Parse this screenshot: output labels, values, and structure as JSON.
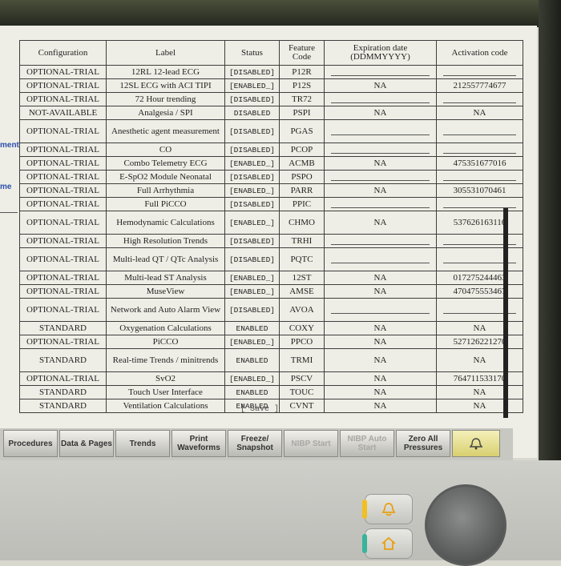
{
  "left_panel": {
    "item1": "ment",
    "item2": "me"
  },
  "table": {
    "headers": [
      "Configuration",
      "Label",
      "Status",
      "Feature Code",
      "Expiration date (DDMMYYYY)",
      "Activation code"
    ],
    "rows": [
      {
        "config": "OPTIONAL-TRIAL",
        "label": "12RL 12-lead ECG",
        "status": "[DISABLED]",
        "code": "P12R",
        "exp": "",
        "act": ""
      },
      {
        "config": "OPTIONAL-TRIAL",
        "label": "12SL ECG with ACI TIPI",
        "status": "[ENABLED_]",
        "code": "P12S",
        "exp": "NA",
        "act": "212557774677"
      },
      {
        "config": "OPTIONAL-TRIAL",
        "label": "72 Hour trending",
        "status": "[DISABLED]",
        "code": "TR72",
        "exp": "",
        "act": ""
      },
      {
        "config": "NOT-AVAILABLE",
        "label": "Analgesia / SPI",
        "status": "DISABLED",
        "code": "PSPI",
        "exp": "NA",
        "act": "NA"
      },
      {
        "config": "OPTIONAL-TRIAL",
        "label": "Anesthetic agent measurement",
        "status": "[DISABLED]",
        "code": "PGAS",
        "exp": "",
        "act": ""
      },
      {
        "config": "OPTIONAL-TRIAL",
        "label": "CO",
        "status": "[DISABLED]",
        "code": "PCOP",
        "exp": "",
        "act": ""
      },
      {
        "config": "OPTIONAL-TRIAL",
        "label": "Combo Telemetry ECG",
        "status": "[ENABLED_]",
        "code": "ACMB",
        "exp": "NA",
        "act": "475351677016"
      },
      {
        "config": "OPTIONAL-TRIAL",
        "label": "E-SpO2 Module Neonatal",
        "status": "[DISABLED]",
        "code": "PSPO",
        "exp": "",
        "act": ""
      },
      {
        "config": "OPTIONAL-TRIAL",
        "label": "Full Arrhythmia",
        "status": "[ENABLED_]",
        "code": "PARR",
        "exp": "NA",
        "act": "305531070461"
      },
      {
        "config": "OPTIONAL-TRIAL",
        "label": "Full PiCCO",
        "status": "[DISABLED]",
        "code": "PPIC",
        "exp": "",
        "act": ""
      },
      {
        "config": "OPTIONAL-TRIAL",
        "label": "Hemodynamic Calculations",
        "status": "[ENABLED_]",
        "code": "CHMO",
        "exp": "NA",
        "act": "537626163116"
      },
      {
        "config": "OPTIONAL-TRIAL",
        "label": "High Resolution Trends",
        "status": "[DISABLED]",
        "code": "TRHI",
        "exp": "",
        "act": ""
      },
      {
        "config": "OPTIONAL-TRIAL",
        "label": "Multi-lead QT / QTc Analysis",
        "status": "[DISABLED]",
        "code": "PQTC",
        "exp": "",
        "act": ""
      },
      {
        "config": "OPTIONAL-TRIAL",
        "label": "Multi-lead ST Analysis",
        "status": "[ENABLED_]",
        "code": "12ST",
        "exp": "NA",
        "act": "017275244463"
      },
      {
        "config": "OPTIONAL-TRIAL",
        "label": "MuseView",
        "status": "[ENABLED_]",
        "code": "AMSE",
        "exp": "NA",
        "act": "470475553467"
      },
      {
        "config": "OPTIONAL-TRIAL",
        "label": "Network and Auto Alarm View",
        "status": "[DISABLED]",
        "code": "AVOA",
        "exp": "",
        "act": ""
      },
      {
        "config": "STANDARD",
        "label": "Oxygenation Calculations",
        "status": "ENABLED",
        "code": "COXY",
        "exp": "NA",
        "act": "NA"
      },
      {
        "config": "OPTIONAL-TRIAL",
        "label": "PiCCO",
        "status": "[ENABLED_]",
        "code": "PPCO",
        "exp": "NA",
        "act": "527126221270"
      },
      {
        "config": "STANDARD",
        "label": "Real-time Trends / minitrends",
        "status": "ENABLED",
        "code": "TRMI",
        "exp": "NA",
        "act": "NA"
      },
      {
        "config": "OPTIONAL-TRIAL",
        "label": "SvO2",
        "status": "[ENABLED_]",
        "code": "PSCV",
        "exp": "NA",
        "act": "764711533170"
      },
      {
        "config": "STANDARD",
        "label": "Touch User Interface",
        "status": "ENABLED",
        "code": "TOUC",
        "exp": "NA",
        "act": "NA"
      },
      {
        "config": "STANDARD",
        "label": "Ventilation Calculations",
        "status": "ENABLED",
        "code": "CVNT",
        "exp": "NA",
        "act": "NA"
      }
    ]
  },
  "save_label": "[ Save ]",
  "bottom_buttons": [
    {
      "label": "Procedures",
      "enabled": true
    },
    {
      "label": "Data & Pages",
      "enabled": true
    },
    {
      "label": "Trends",
      "enabled": true
    },
    {
      "label": "Print Waveforms",
      "enabled": true
    },
    {
      "label": "Freeze/ Snapshot",
      "enabled": true
    },
    {
      "label": "NIBP Start",
      "enabled": false
    },
    {
      "label": "NIBP Auto Start",
      "enabled": false
    },
    {
      "label": "Zero All Pressures",
      "enabled": true
    }
  ],
  "colors": {
    "accent_link": "#2b4fae",
    "alarm_button": "#e6dd84",
    "alarm_key_led": "#f0c020",
    "home_key_led": "#39b39c"
  },
  "icons": {
    "alarm_button": "bell-alarm-icon",
    "alarm_key": "alarm-bell-icon",
    "home_key": "home-icon"
  }
}
